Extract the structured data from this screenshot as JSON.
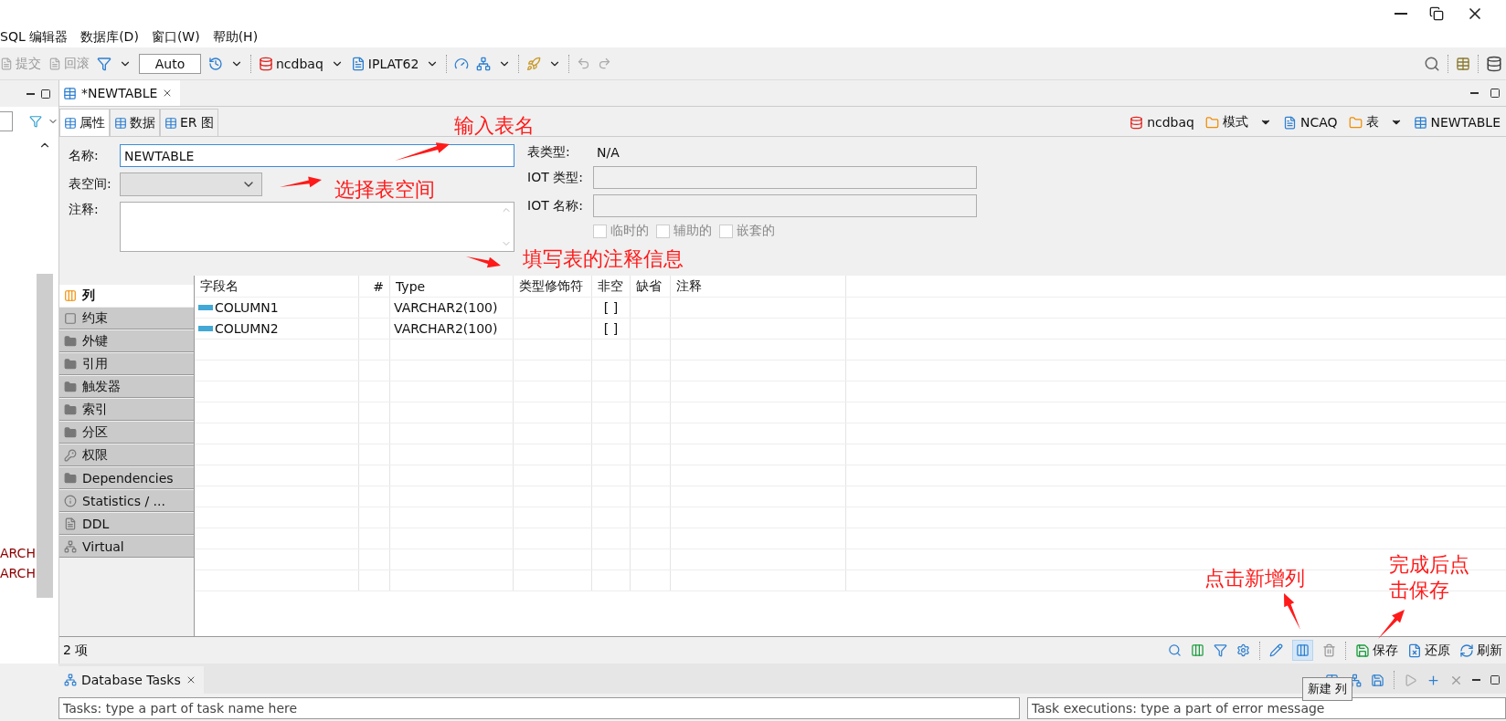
{
  "menu": [
    {
      "label": "SQL 编辑器"
    },
    {
      "label": "数据库(D)"
    },
    {
      "label": "窗口(W)"
    },
    {
      "label": "帮助(H)"
    }
  ],
  "toolbar": {
    "actions": [
      {
        "label": "提交",
        "disabled": true
      },
      {
        "label": "回滚",
        "disabled": true
      }
    ],
    "mode": "Auto",
    "connection": "ncdbaq",
    "schema": "IPLAT62"
  },
  "left_panel": {
    "texts": [
      "ARCH",
      "ARCH"
    ]
  },
  "editor_tab": {
    "label": "*NEWTABLE"
  },
  "subtabs": [
    {
      "label": "属性",
      "selected": true
    },
    {
      "label": "数据",
      "selected": false
    },
    {
      "label": "ER 图",
      "selected": false
    }
  ],
  "breadcrumb": [
    {
      "label": "ncdbaq",
      "kind": "connection"
    },
    {
      "label": "模式",
      "kind": "folder"
    },
    {
      "label": "NCAQ",
      "kind": "schema"
    },
    {
      "label": "表",
      "kind": "folder"
    },
    {
      "label": "NEWTABLE",
      "kind": "table"
    }
  ],
  "form": {
    "name_label": "名称:",
    "name_value": "NEWTABLE",
    "tablespace_label": "表空间:",
    "comment_label": "注释:",
    "table_type_label": "表类型:",
    "table_type_value": "N/A",
    "iot_type_label": "IOT 类型:",
    "iot_name_label": "IOT 名称:",
    "checkboxes": [
      {
        "label": "临时的",
        "checked": false,
        "disabled": true
      },
      {
        "label": "辅助的",
        "checked": false,
        "disabled": true
      },
      {
        "label": "嵌套的",
        "checked": false,
        "disabled": true
      }
    ]
  },
  "side_tabs": [
    {
      "label": "列",
      "selected": true,
      "kind": "columns"
    },
    {
      "label": "约束",
      "selected": false,
      "kind": "constraint"
    },
    {
      "label": "外键",
      "selected": false,
      "kind": "folder"
    },
    {
      "label": "引用",
      "selected": false,
      "kind": "folder"
    },
    {
      "label": "触发器",
      "selected": false,
      "kind": "folder"
    },
    {
      "label": "索引",
      "selected": false,
      "kind": "folder"
    },
    {
      "label": "分区",
      "selected": false,
      "kind": "folder"
    },
    {
      "label": "权限",
      "selected": false,
      "kind": "key"
    },
    {
      "label": "Dependencies",
      "selected": false,
      "kind": "folder"
    },
    {
      "label": "Statistics / ...",
      "selected": false,
      "kind": "info"
    },
    {
      "label": "DDL",
      "selected": false,
      "kind": "ddl"
    },
    {
      "label": "Virtual",
      "selected": false,
      "kind": "virtual"
    }
  ],
  "table": {
    "columns": [
      "字段名",
      "#",
      "Type",
      "类型修饰符",
      "非空",
      "缺省",
      "注释"
    ],
    "rows": [
      [
        "COLUMN1",
        "",
        "VARCHAR2(100)",
        "",
        "[ ]",
        "",
        ""
      ],
      [
        "COLUMN2",
        "",
        "VARCHAR2(100)",
        "",
        "[ ]",
        "",
        ""
      ]
    ]
  },
  "status_bar": {
    "count": "2 项",
    "buttons": [
      {
        "label": "保存",
        "kind": "save"
      },
      {
        "label": "还原",
        "kind": "revert"
      },
      {
        "label": "刷新",
        "kind": "refresh"
      }
    ]
  },
  "tasks_panel": {
    "title": "Database Tasks",
    "task_filter": {
      "placeholder": "Tasks: type a part of task name here"
    },
    "execution_filter": {
      "placeholder": "Task executions: type a part of error message"
    }
  },
  "tooltip": "新建 列",
  "annotations": [
    {
      "text": "输入表名"
    },
    {
      "text": "选择表空间"
    },
    {
      "text": "填写表的注释信息"
    },
    {
      "text": "点击新增列"
    },
    {
      "text": "完成后点击保存"
    }
  ]
}
